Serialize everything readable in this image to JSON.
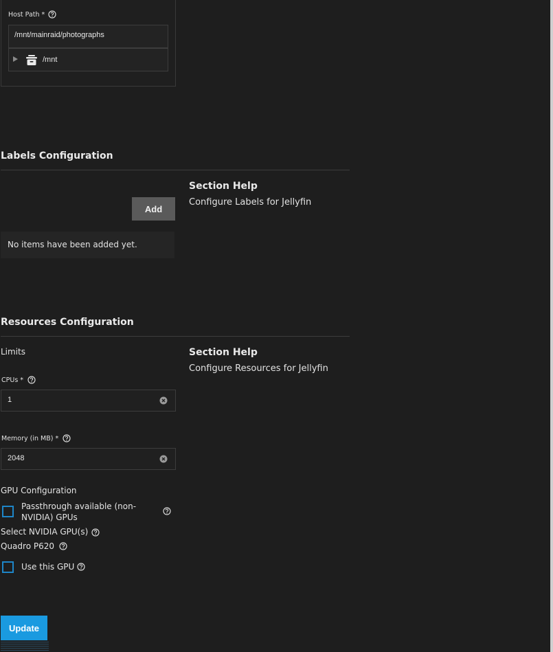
{
  "host_path": {
    "label": "Host Path *",
    "value": "/mnt/mainraid/photographs",
    "tree_root": "/mnt"
  },
  "labels": {
    "title": "Labels Configuration",
    "add_label": "Add",
    "empty_text": "No items have been added yet.",
    "help_title": "Section Help",
    "help_text": "Configure Labels for Jellyfin"
  },
  "resources": {
    "title": "Resources Configuration",
    "limits_label": "Limits",
    "help_title": "Section Help",
    "help_text": "Configure Resources for Jellyfin",
    "cpus": {
      "label": "CPUs *",
      "value": "1"
    },
    "memory": {
      "label": "Memory (in MB) *",
      "value": "2048"
    },
    "gpu": {
      "heading": "GPU Configuration",
      "passthrough_label": "Passthrough available (non-NVIDIA) GPUs",
      "passthrough_checked": false,
      "select_label": "Select NVIDIA GPU(s)",
      "device_name": "Quadro P620",
      "use_label": "Use this GPU",
      "use_checked": false
    }
  },
  "actions": {
    "update_label": "Update"
  },
  "colors": {
    "accent": "#1a9ae0",
    "checkbox_border": "#1e86c8",
    "background": "#1e1e1e"
  },
  "icons": {
    "help": "help-circle-icon",
    "clear": "clear-icon",
    "dataset": "dataset-icon",
    "expand": "chevron-right-icon"
  }
}
